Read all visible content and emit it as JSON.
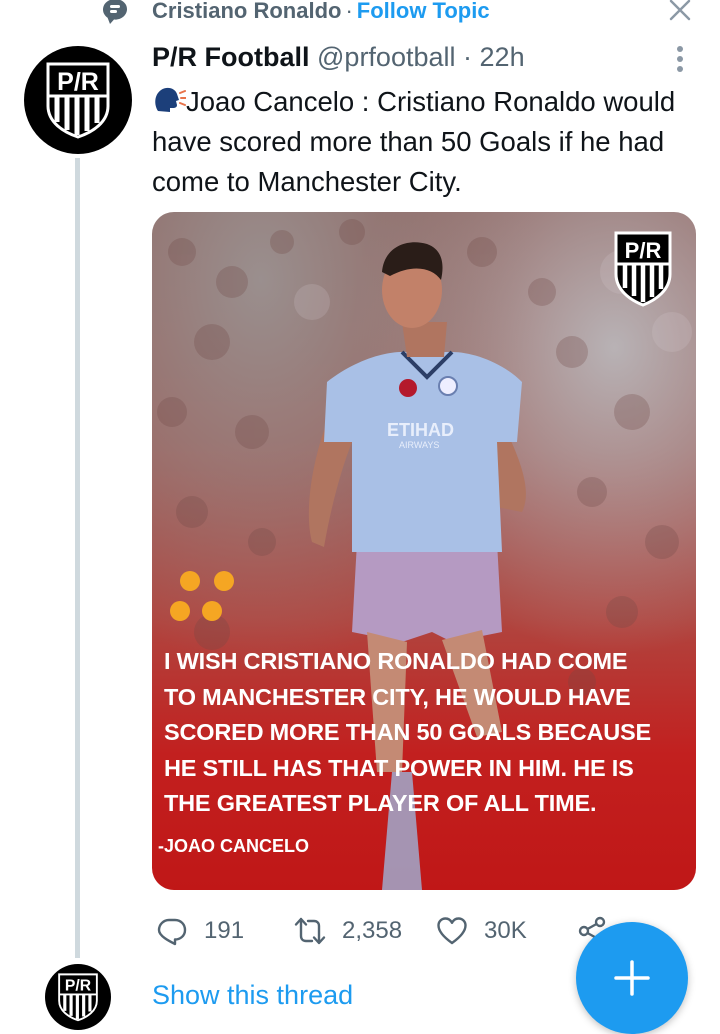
{
  "topic": {
    "name": "Cristiano Ronaldo",
    "separator": "·",
    "follow_label": "Follow Topic"
  },
  "tweet": {
    "author_name": "P/R Football",
    "author_handle": "@prfootball",
    "separator": "·",
    "time": "22h",
    "text": "Joao Cancelo : Cristiano Ronaldo would have scored more than 50 Goals if he had come to Manchester City.",
    "media": {
      "logo_text": "P/R",
      "quote_lines": [
        "I WISH CRISTIANO RONALDO HAD COME",
        "TO MANCHESTER CITY, HE WOULD HAVE",
        "SCORED MORE THAN 50 GOALS BECAUSE",
        "HE STILL HAS THAT POWER IN HIM. HE IS",
        "THE GREATEST PLAYER OF ALL TIME."
      ],
      "quote_author": "-JOAO CANCELO",
      "sponsor_text": "ETIHAD",
      "sponsor_sub": "AIRWAYS"
    },
    "stats": {
      "replies": "191",
      "retweets": "2,358",
      "likes": "30K"
    }
  },
  "thread_link": "Show this thread",
  "avatar_text": "P/R",
  "colors": {
    "accent": "#1d9bf0",
    "muted": "#536471",
    "thread_line": "#cfd9de",
    "quote_red": "#c01717",
    "dots_yellow": "#f5a623"
  },
  "icons": [
    "topic-icon",
    "close-icon",
    "more-icon",
    "speaking-head-icon",
    "reply-icon",
    "retweet-icon",
    "like-icon",
    "share-icon",
    "compose-plus-icon"
  ]
}
